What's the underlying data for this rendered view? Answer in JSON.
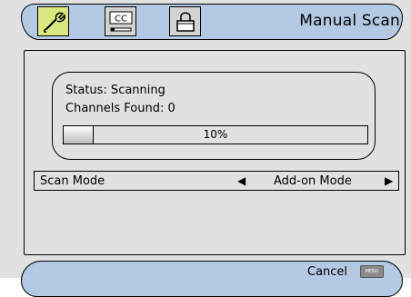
{
  "header": {
    "title": "Manual Scan",
    "tabs": [
      {
        "icon": "wrench-icon",
        "selected": true
      },
      {
        "icon": "cc-icon",
        "label": "CC",
        "selected": false
      },
      {
        "icon": "lock-icon",
        "selected": false
      }
    ]
  },
  "status": {
    "status_text": "Status: Scanning",
    "channels_text": "Channels Found: 0",
    "progress_label": "10%",
    "progress_value": 0.1
  },
  "scan_mode": {
    "label": "Scan Mode",
    "value": "Add-on Mode",
    "left_arrow": "◀",
    "right_arrow": "▶"
  },
  "footer": {
    "cancel_label": "Cancel",
    "menu_key_label": "MENU"
  },
  "colors": {
    "tab_bar": "#b4c9e4",
    "selected_tab": "#dbe87f",
    "panel_bg": "#e1e1e1"
  }
}
